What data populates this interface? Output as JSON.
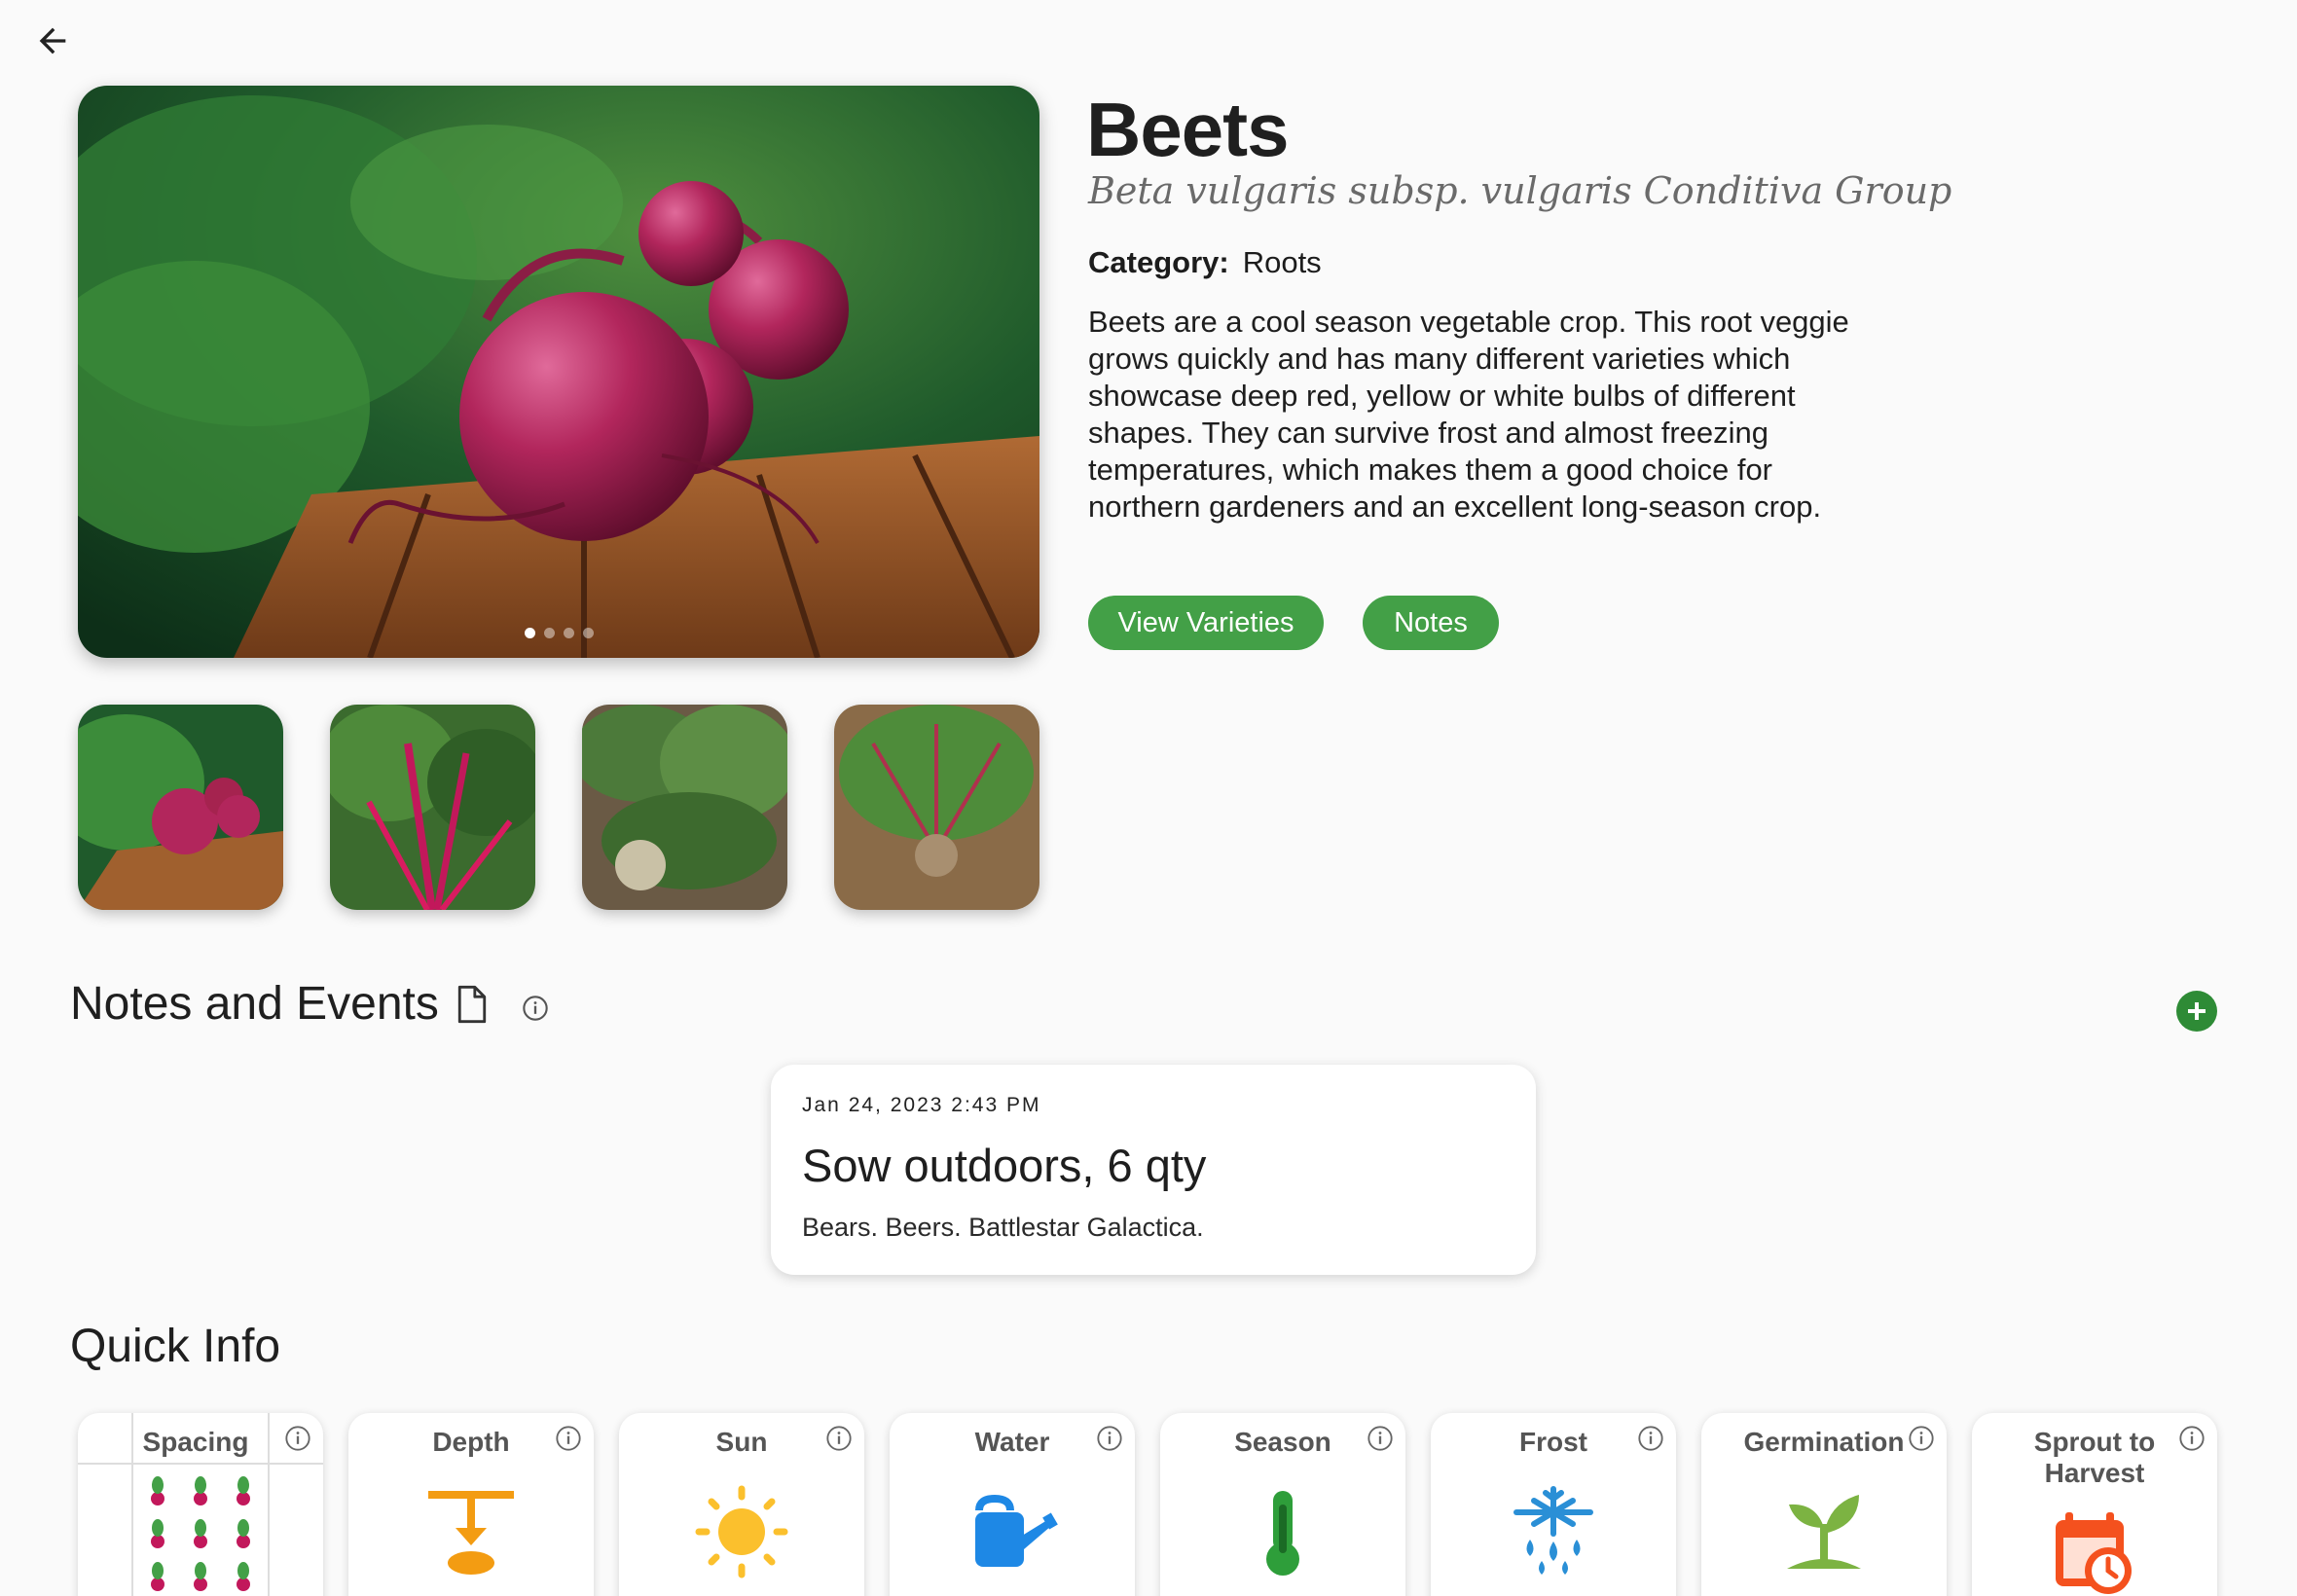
{
  "plant": {
    "name": "Beets",
    "scientific_name": "Beta vulgaris subsp. vulgaris Conditiva Group",
    "category_label": "Category:",
    "category_value": "Roots",
    "description": "Beets are a cool season vegetable crop. This root veggie grows quickly and has many different varieties which showcase deep red, yellow or white bulbs of different shapes. They can survive frost and almost freezing temperatures, which makes them a good choice for northern gardeners and an excellent long-season crop."
  },
  "gallery": {
    "slide_count": 4,
    "active_slide": 1,
    "thumbnails": [
      "beets-on-wood",
      "beet-leaves-red-stems",
      "beet-plant-in-soil",
      "beet-seedling-soil"
    ]
  },
  "actions": {
    "view_varieties": "View Varieties",
    "notes": "Notes"
  },
  "notes_section": {
    "title": "Notes and Events",
    "events": [
      {
        "date": "Jan 24, 2023 2:43 PM",
        "title": "Sow outdoors, 6 qty",
        "body": "Bears. Beers. Battlestar Galactica."
      }
    ]
  },
  "quick_info": {
    "title": "Quick Info",
    "cards": [
      {
        "label": "Spacing",
        "icon": "spacing-grid-icon"
      },
      {
        "label": "Depth",
        "icon": "depth-icon"
      },
      {
        "label": "Sun",
        "icon": "sun-icon"
      },
      {
        "label": "Water",
        "icon": "watering-can-icon"
      },
      {
        "label": "Season",
        "icon": "thermometer-icon"
      },
      {
        "label": "Frost",
        "icon": "frost-icon"
      },
      {
        "label": "Germination",
        "icon": "sprout-icon"
      },
      {
        "label": "Sprout to\nHarvest",
        "icon": "calendar-clock-icon"
      }
    ]
  },
  "colors": {
    "accent_green": "#43a047",
    "add_button_green": "#2e8b36",
    "depth_orange": "#f39c12",
    "sun_yellow": "#fbc02d",
    "water_blue": "#1e88e5",
    "season_green": "#2e9e3a",
    "frost_blue": "#2a8fd6",
    "sprout_green": "#7cb342",
    "calendar_orange": "#f4511e"
  }
}
